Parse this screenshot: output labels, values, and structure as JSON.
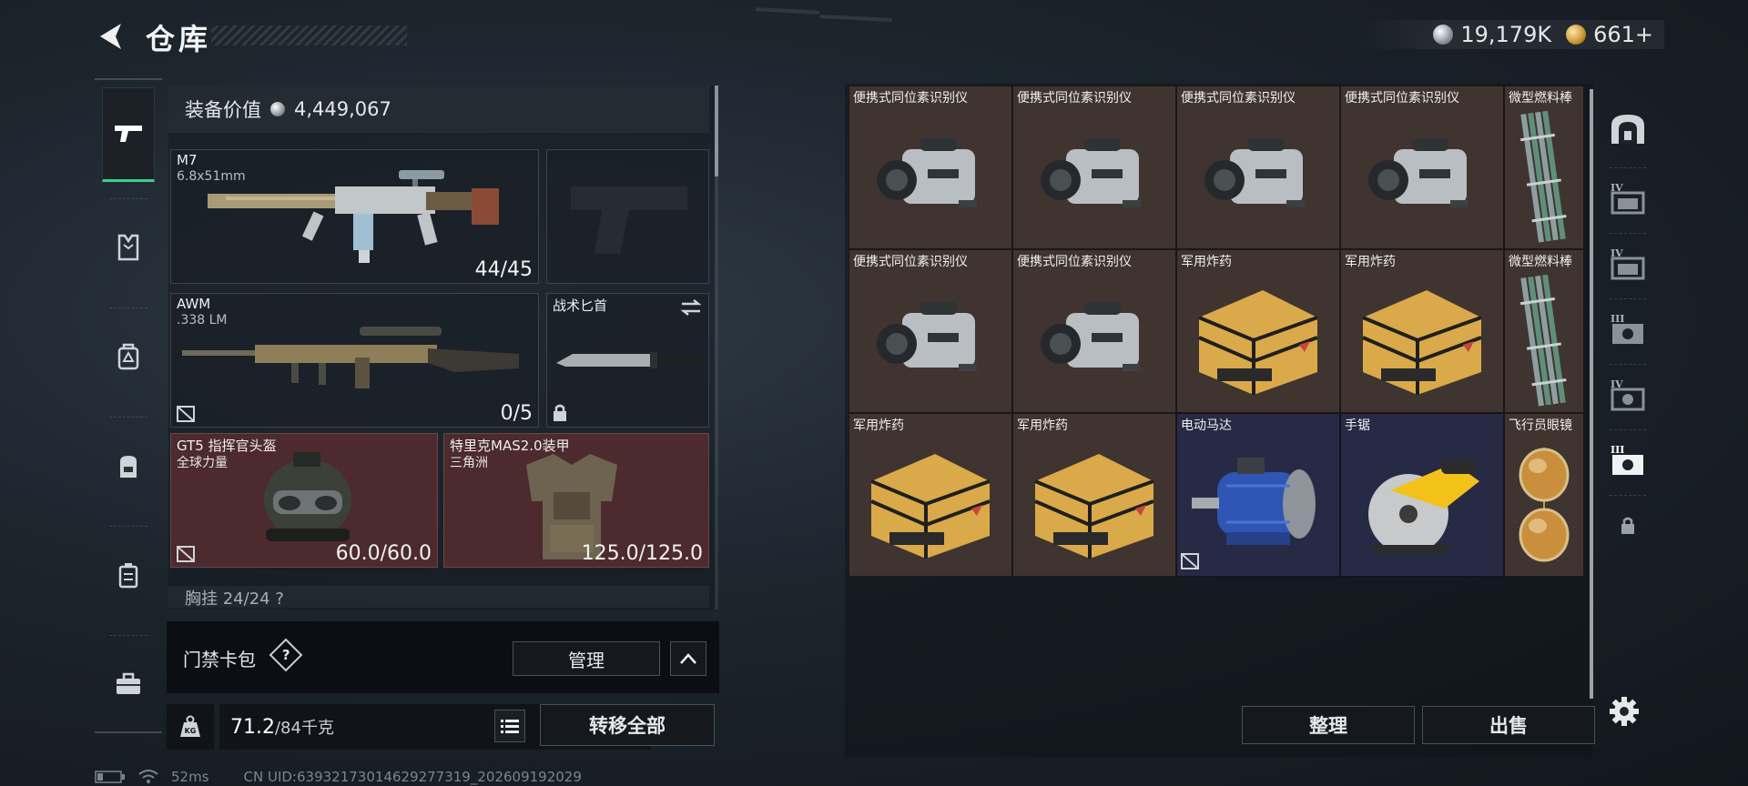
{
  "header": {
    "title": "仓库",
    "currency": [
      {
        "icon": "silver-coin-icon",
        "value": "19,179K"
      },
      {
        "icon": "gold-coin-icon",
        "value": "661+"
      }
    ]
  },
  "left_nav": {
    "items": [
      {
        "icon": "pistol-icon",
        "active": true
      },
      {
        "icon": "armor-vest-icon",
        "active": false
      },
      {
        "icon": "chest-rig-icon",
        "active": false
      },
      {
        "icon": "backpack-icon",
        "active": false
      },
      {
        "icon": "container-icon",
        "active": false
      },
      {
        "icon": "toolbox-icon",
        "active": false
      }
    ]
  },
  "equipment": {
    "value_label": "装备价值",
    "value": "4,449,067",
    "primary_weapon": {
      "name": "M7",
      "caliber": "6.8x51mm",
      "ammo": "44/45"
    },
    "secondary_weapon": {
      "name": "AWM",
      "caliber": ".338 LM",
      "ammo": "0/5"
    },
    "melee": {
      "name": "战术匕首"
    },
    "helmet": {
      "name": "GT5 指挥官头盔",
      "sub": "全球力量",
      "durability": "60.0/60.0"
    },
    "armor": {
      "name": "特里克MAS2.0装甲",
      "sub": "三角洲",
      "durability": "125.0/125.0"
    },
    "chest_rig_partial": "胸挂  24/24  ?"
  },
  "keycard": {
    "label": "门禁卡包",
    "help": "?",
    "manage_label": "管理"
  },
  "weight": {
    "current": "71.2",
    "max": "/84千克",
    "transfer_label": "转移全部"
  },
  "status": {
    "ping": "52ms",
    "uid": "CN UID:6393217301462927731​9_202609192029"
  },
  "storage": {
    "rows": [
      [
        {
          "label": "便携式同位素识别仪",
          "icon": "isotope-detector-icon",
          "bg": "brown"
        },
        {
          "label": "便携式同位素识别仪",
          "icon": "isotope-detector-icon",
          "bg": "brown"
        },
        {
          "label": "便携式同位素识别仪",
          "icon": "isotope-detector-icon",
          "bg": "brown"
        },
        {
          "label": "便携式同位素识别仪",
          "icon": "isotope-detector-icon",
          "bg": "brown"
        },
        {
          "label": "微型燃料棒",
          "icon": "fuel-rod-icon",
          "bg": "brown"
        }
      ],
      [
        {
          "label": "便携式同位素识别仪",
          "icon": "isotope-detector-icon",
          "bg": "brown"
        },
        {
          "label": "便携式同位素识别仪",
          "icon": "isotope-detector-icon",
          "bg": "brown"
        },
        {
          "label": "军用炸药",
          "icon": "explosive-crate-icon",
          "bg": "brown"
        },
        {
          "label": "军用炸药",
          "icon": "explosive-crate-icon",
          "bg": "brown"
        },
        {
          "label": "微型燃料棒",
          "icon": "fuel-rod-icon",
          "bg": "brown"
        }
      ],
      [
        {
          "label": "军用炸药",
          "icon": "explosive-crate-icon",
          "bg": "brown"
        },
        {
          "label": "军用炸药",
          "icon": "explosive-crate-icon",
          "bg": "brown"
        },
        {
          "label": "电动马达",
          "icon": "electric-motor-icon",
          "bg": "navy"
        },
        {
          "label": "手锯",
          "icon": "circular-saw-icon",
          "bg": "navy"
        },
        {
          "label": "飞行员眼镜",
          "icon": "aviator-glasses-icon",
          "bg": "brown"
        }
      ]
    ],
    "sort_label": "整理",
    "sell_label": "出售"
  },
  "right_rail": {
    "items": [
      "safe-box-icon",
      "case-iv-icon",
      "case-iv-icon",
      "case-iii-icon",
      "case-iv-icon",
      "case-iii-icon",
      "lock-icon"
    ]
  },
  "colors": {
    "accent_green": "#3ccf8e",
    "item_brown": "#3f3430",
    "item_navy": "#262a44",
    "slot_red": "#4d2a2d"
  }
}
